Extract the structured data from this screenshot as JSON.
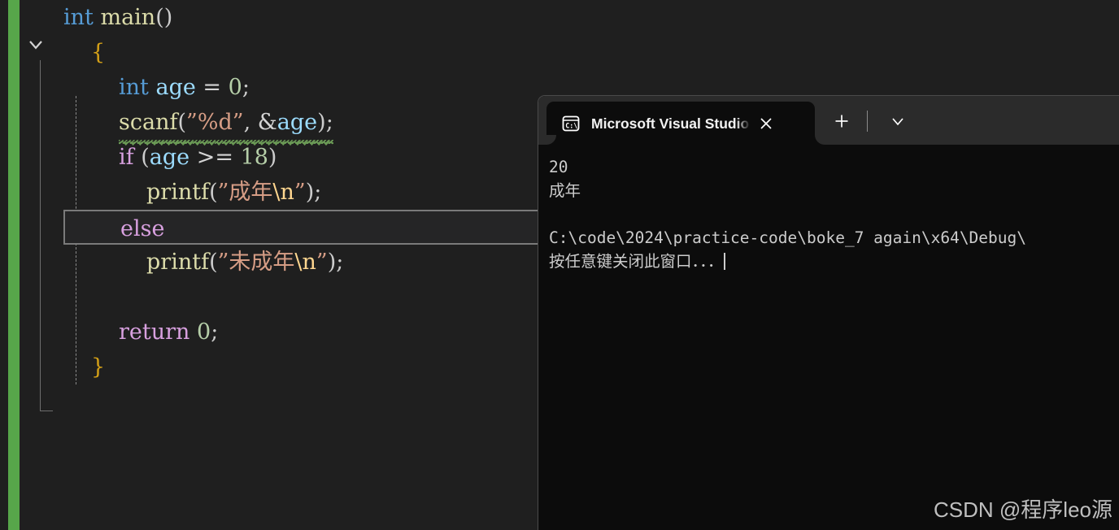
{
  "editor": {
    "change_bar_color": "#57a64a",
    "background_color": "#1f1f1f",
    "fold_icon": "chevron-down-icon",
    "current_line_index": 6,
    "lines": [
      {
        "indent": 0,
        "tokens": [
          {
            "t": "int",
            "c": "kw"
          },
          {
            "t": " ",
            "c": "punct"
          },
          {
            "t": "main",
            "c": "fn"
          },
          {
            "t": "()",
            "c": "punct"
          }
        ]
      },
      {
        "indent": 1,
        "tokens": [
          {
            "t": "{",
            "c": "brace"
          }
        ]
      },
      {
        "indent": 2,
        "tokens": [
          {
            "t": "int",
            "c": "kw"
          },
          {
            "t": " ",
            "c": "punct"
          },
          {
            "t": "age",
            "c": "var"
          },
          {
            "t": " ",
            "c": "punct"
          },
          {
            "t": "=",
            "c": "op"
          },
          {
            "t": " ",
            "c": "punct"
          },
          {
            "t": "0",
            "c": "num"
          },
          {
            "t": ";",
            "c": "punct"
          }
        ]
      },
      {
        "indent": 2,
        "squiggle": true,
        "tokens": [
          {
            "t": "scanf",
            "c": "fn"
          },
          {
            "t": "(",
            "c": "punct"
          },
          {
            "t": "”%d”",
            "c": "str"
          },
          {
            "t": ",",
            "c": "punct"
          },
          {
            "t": " ",
            "c": "punct"
          },
          {
            "t": "&",
            "c": "op"
          },
          {
            "t": "age",
            "c": "var"
          },
          {
            "t": ")",
            "c": "punct"
          },
          {
            "t": ";",
            "c": "punct"
          }
        ]
      },
      {
        "indent": 2,
        "tokens": [
          {
            "t": "if",
            "c": "ctl"
          },
          {
            "t": " (",
            "c": "punct"
          },
          {
            "t": "age",
            "c": "var"
          },
          {
            "t": " ",
            "c": "punct"
          },
          {
            "t": ">=",
            "c": "op"
          },
          {
            "t": " ",
            "c": "punct"
          },
          {
            "t": "18",
            "c": "num"
          },
          {
            "t": ")",
            "c": "punct"
          }
        ]
      },
      {
        "indent": 3,
        "tokens": [
          {
            "t": "printf",
            "c": "fn"
          },
          {
            "t": "(",
            "c": "punct"
          },
          {
            "t": "”成年",
            "c": "str"
          },
          {
            "t": "\\n",
            "c": "esc"
          },
          {
            "t": "”",
            "c": "str"
          },
          {
            "t": ")",
            "c": "punct"
          },
          {
            "t": ";",
            "c": "punct"
          }
        ]
      },
      {
        "indent": 2,
        "current": true,
        "tokens": [
          {
            "t": "else",
            "c": "ctl"
          }
        ]
      },
      {
        "indent": 3,
        "tokens": [
          {
            "t": "printf",
            "c": "fn"
          },
          {
            "t": "(",
            "c": "punct"
          },
          {
            "t": "”未成年",
            "c": "str"
          },
          {
            "t": "\\n",
            "c": "esc"
          },
          {
            "t": "”",
            "c": "str"
          },
          {
            "t": ")",
            "c": "punct"
          },
          {
            "t": ";",
            "c": "punct"
          }
        ]
      },
      {
        "indent": 0,
        "tokens": []
      },
      {
        "indent": 2,
        "tokens": [
          {
            "t": "return",
            "c": "ctl"
          },
          {
            "t": " ",
            "c": "punct"
          },
          {
            "t": "0",
            "c": "num"
          },
          {
            "t": ";",
            "c": "punct"
          }
        ]
      },
      {
        "indent": 1,
        "tokens": [
          {
            "t": "}",
            "c": "brace"
          }
        ]
      }
    ]
  },
  "console": {
    "tab": {
      "icon": "command-prompt-icon",
      "title": "Microsoft Visual Studio 调试控",
      "close_label": "×"
    },
    "new_tab_label": "+",
    "dropdown_label": "⌄",
    "output_lines": [
      "20",
      "成年",
      "",
      "C:\\code\\2024\\practice-code\\boke_7 again\\x64\\Debug\\",
      "按任意键关闭此窗口．．．"
    ],
    "background_color": "#0c0c0c",
    "titlebar_color": "#2b2b2b"
  },
  "watermark": {
    "text": "CSDN @程序leo源"
  }
}
